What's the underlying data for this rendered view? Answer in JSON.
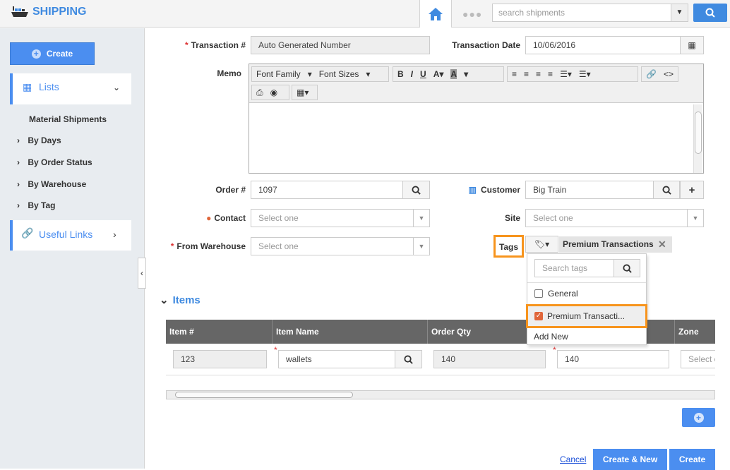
{
  "header": {
    "app_title": "SHIPPING",
    "search_placeholder": "search shipments"
  },
  "sidebar": {
    "create_label": "Create",
    "lists_label": "Lists",
    "items": [
      {
        "label": "Material Shipments"
      },
      {
        "label": "By Days"
      },
      {
        "label": "By Order Status"
      },
      {
        "label": "By Warehouse"
      },
      {
        "label": "By Tag"
      }
    ],
    "useful_links_label": "Useful Links"
  },
  "form": {
    "transaction_label": "Transaction #",
    "transaction_value": "Auto Generated Number",
    "date_label": "Transaction Date",
    "date_value": "10/06/2016",
    "memo_label": "Memo",
    "font_family": "Font Family",
    "font_sizes": "Font Sizes",
    "order_label": "Order #",
    "order_value": "1097",
    "customer_label": "Customer",
    "customer_value": "Big Train",
    "contact_label": "Contact",
    "contact_placeholder": "Select one",
    "site_label": "Site",
    "site_placeholder": "Select one",
    "warehouse_label": "From Warehouse",
    "warehouse_placeholder": "Select one",
    "tags_label": "Tags",
    "selected_tag": "Premium Transactions"
  },
  "tags_dropdown": {
    "search_placeholder": "Search tags",
    "options": [
      {
        "label": "General",
        "checked": false
      },
      {
        "label": "Premium Transacti...",
        "checked": true
      }
    ],
    "add_new": "Add New"
  },
  "items": {
    "title": "Items",
    "columns": [
      "Item #",
      "Item Name",
      "Order Qty",
      "",
      "Zone"
    ],
    "row": {
      "item_no": "123",
      "item_name": "wallets",
      "order_qty": "140",
      "qty": "140",
      "zone_placeholder": "Select o"
    }
  },
  "footer": {
    "cancel": "Cancel",
    "create_new": "Create & New",
    "create": "Create"
  },
  "colors": {
    "accent": "#4b8ef0",
    "highlight": "#f7941d",
    "table_header": "#666666"
  }
}
